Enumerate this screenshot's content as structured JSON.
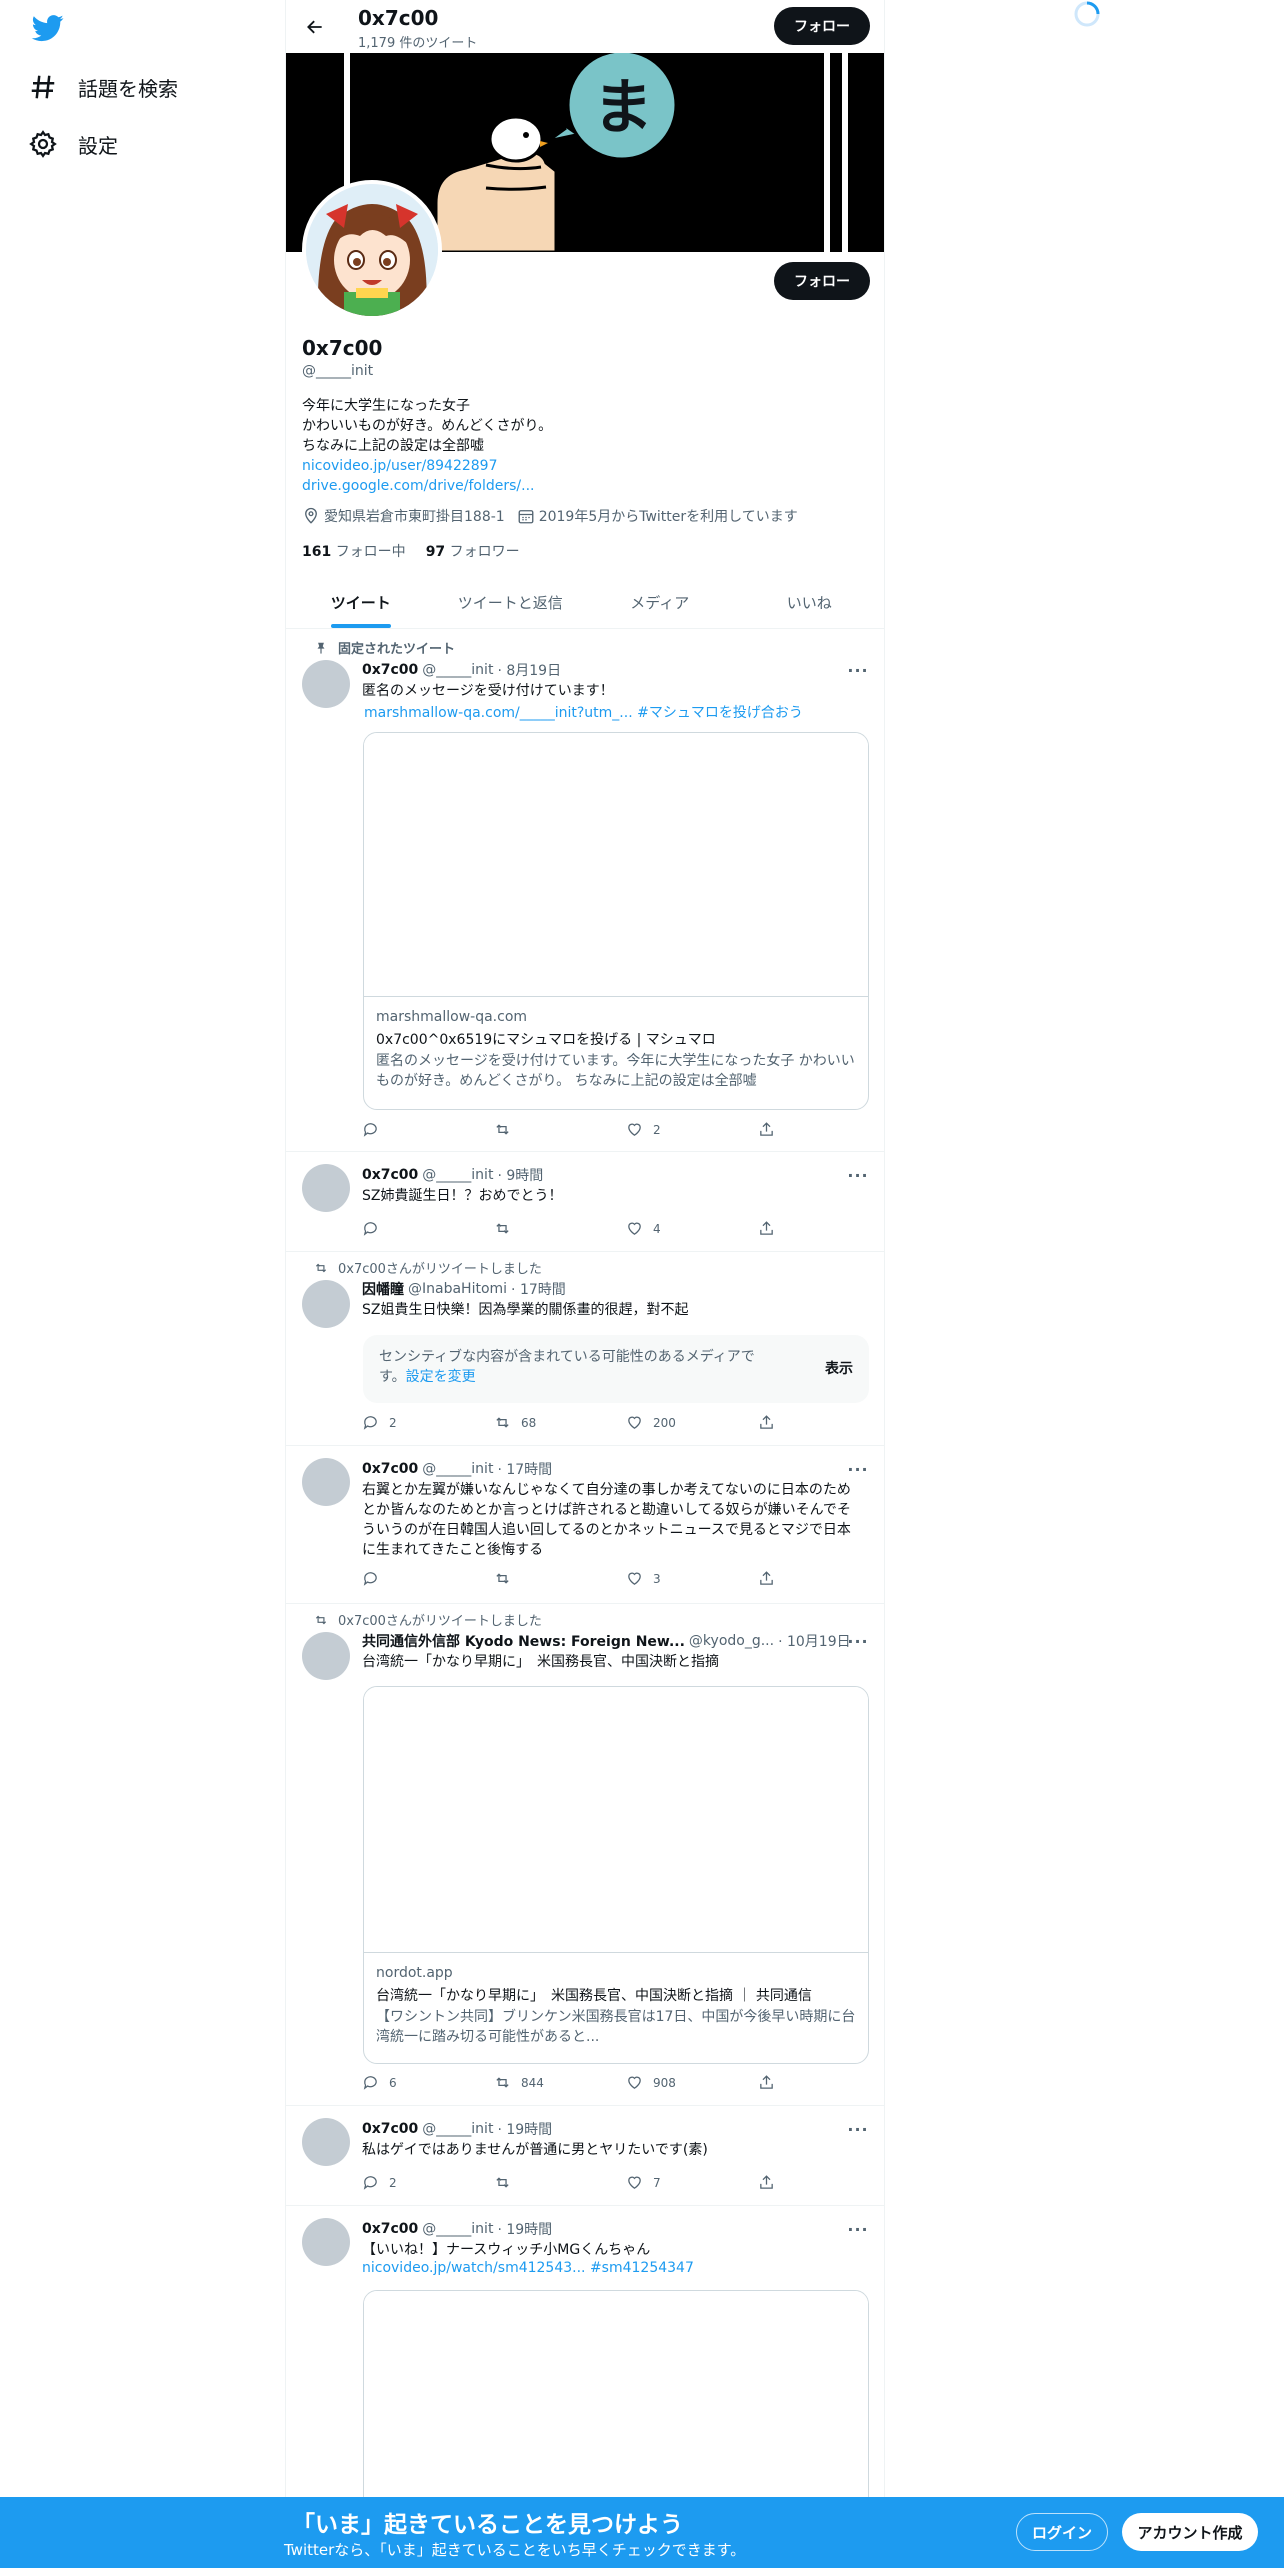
{
  "sidebar": {
    "items": [
      {
        "label": "話題を検索",
        "icon": "hashtag-icon"
      },
      {
        "label": "設定",
        "icon": "gear-icon"
      }
    ]
  },
  "header": {
    "name": "0x7c00",
    "tweet_count": "1,179 件のツイート",
    "follow_label": "フォロー"
  },
  "profile": {
    "name": "0x7c00",
    "handle": "@_____init",
    "follow_label": "フォロー",
    "banner_glyph": "ま",
    "bio_lines": [
      "今年に大学生になった女子",
      "かわいいものが好き。めんどくさがり。",
      "ちなみに上記の設定は全部嘘"
    ],
    "links": [
      "nicovideo.jp/user/89422897",
      "drive.google.com/drive/folders/..."
    ],
    "location": "愛知県岩倉市東町掛目188-1",
    "joined": "2019年5月からTwitterを利用しています",
    "following_count": "161",
    "following_label": "フォロー中",
    "followers_count": "97",
    "followers_label": "フォロワー"
  },
  "tabs": [
    "ツイート",
    "ツイートと返信",
    "メディア",
    "いいね"
  ],
  "tweets": [
    {
      "social": "固定されたツイート",
      "name": "0x7c00",
      "handle": "@_____init",
      "time": "· 8月19日",
      "text": "匿名のメッセージを受け付けています！",
      "link": "marshmallow-qa.com/_____init?utm_... #マシュマロを投げ合おう",
      "card": {
        "domain": "marshmallow-qa.com",
        "title": "0x7c00^0x6519にマシュマロを投げる | マシュマロ",
        "desc": "匿名のメッセージを受け付けています。今年に大学生になった女子 かわいいものが好き。めんどくさがり。 ちなみに上記の設定は全部嘘"
      },
      "replies": "",
      "retweets": "",
      "likes": "2"
    },
    {
      "name": "0x7c00",
      "handle": "@_____init",
      "time": "· 9時間",
      "text": "SZ姉貴誕生日！？おめでとう！",
      "replies": "",
      "retweets": "",
      "likes": "4"
    },
    {
      "social": "0x7c00さんがリツイートしました",
      "name": "因幡瞳",
      "handle": "@InabaHitomi",
      "time": "· 17時間",
      "text": "SZ姐貴生日快樂！因為學業的關係畫的很趕，對不起",
      "sensitive_text": "センシティブな内容が含まれている可能性のあるメディアです。",
      "sensitive_link": "設定を変更",
      "sensitive_button": "表示",
      "replies": "2",
      "retweets": "68",
      "likes": "200"
    },
    {
      "name": "0x7c00",
      "handle": "@_____init",
      "time": "· 17時間",
      "text": "右翼とか左翼が嫌いなんじゃなくて自分達の事しか考えてないのに日本のためとか皆んなのためとか言っとけば許されると勘違いしてる奴らが嫌いそんでそういうのが在日韓国人追い回してるのとかネットニュースで見るとマジで日本に生まれてきたこと後悔する",
      "replies": "",
      "retweets": "",
      "likes": "3"
    },
    {
      "social": "0x7c00さんがリツイートしました",
      "name": "共同通信外信部 Kyodo News: Foreign New...",
      "handle": "@kyodo_g...",
      "time": "· 10月19日",
      "text": "台湾統一「かなり早期に」　米国務長官、中国決断と指摘",
      "card": {
        "domain": "nordot.app",
        "title": "台湾統一「かなり早期に」　米国務長官、中国決断と指摘 ｜ 共同通信",
        "desc": "【ワシントン共同】ブリンケン米国務長官は17日、中国が今後早い時期に台湾統一に踏み切る可能性があると..."
      },
      "replies": "6",
      "retweets": "844",
      "likes": "908"
    },
    {
      "name": "0x7c00",
      "handle": "@_____init",
      "time": "· 19時間",
      "text": "私はゲイではありませんが普通に男とヤリたいです(素)",
      "replies": "2",
      "retweets": "",
      "likes": "7"
    },
    {
      "name": "0x7c00",
      "handle": "@_____init",
      "time": "· 19時間",
      "text": "【いいね！】ナースウィッチ小MGくんちゃん",
      "link": "nicovideo.jp/watch/sm412543... #sm41254347",
      "replies": "",
      "retweets": "",
      "likes": ""
    }
  ],
  "bottom_bar": {
    "title": "「いま」起きていることを見つけよう",
    "subtitle": "Twitterなら、「いま」起きていることをいち早くチェックできます。",
    "login": "ログイン",
    "signup": "アカウント作成"
  },
  "colors": {
    "accent": "#1d9bf0",
    "text": "#0f1419",
    "secondary": "#536471",
    "button_dark": "#0f1419"
  }
}
